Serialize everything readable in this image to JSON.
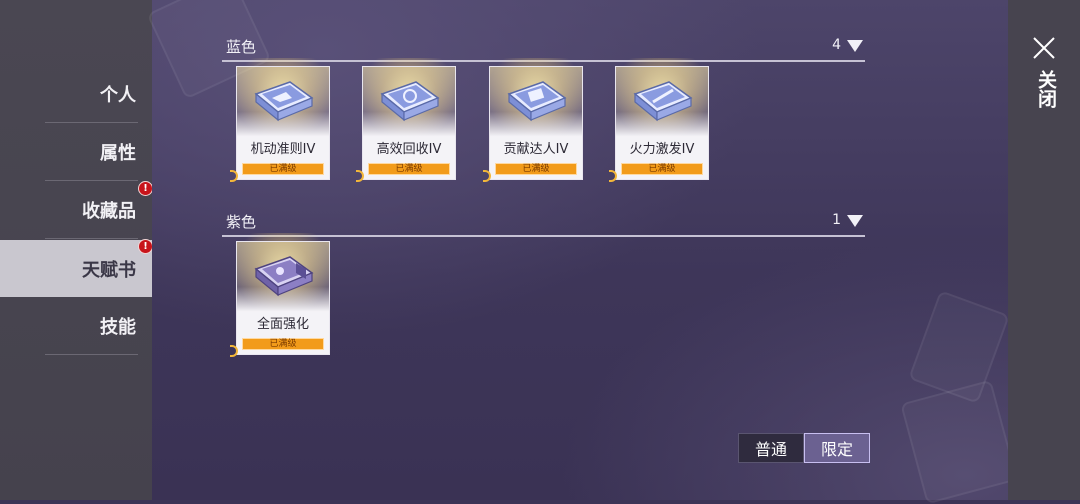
{
  "sidebar": {
    "items": [
      {
        "label": "个人",
        "active": false,
        "alert": false
      },
      {
        "label": "属性",
        "active": false,
        "alert": false
      },
      {
        "label": "收藏品",
        "active": false,
        "alert": true
      },
      {
        "label": "天赋书",
        "active": true,
        "alert": true
      },
      {
        "label": "技能",
        "active": false,
        "alert": false
      }
    ],
    "alert_glyph": "!"
  },
  "sections": [
    {
      "name": "蓝色",
      "count": "4",
      "cards": [
        {
          "label": "机动准则IV",
          "badge": "已满级",
          "icon": "blue-book-icon"
        },
        {
          "label": "高效回收IV",
          "badge": "已满级",
          "icon": "blue-book-icon"
        },
        {
          "label": "贡献达人IV",
          "badge": "已满级",
          "icon": "blue-book-icon"
        },
        {
          "label": "火力激发IV",
          "badge": "已满级",
          "icon": "blue-book-icon"
        }
      ]
    },
    {
      "name": "紫色",
      "count": "1",
      "cards": [
        {
          "label": "全面强化",
          "badge": "已满级",
          "icon": "purple-book-icon"
        }
      ]
    }
  ],
  "filter": {
    "normal_label": "普通",
    "limited_label": "限定",
    "selected": "限定"
  },
  "close": {
    "label": "关闭"
  },
  "colors": {
    "accent_orange": "#f29b1a",
    "alert_red": "#c8141b",
    "blue_book": "#8a9be0",
    "purple_book": "#8c7fc4"
  }
}
